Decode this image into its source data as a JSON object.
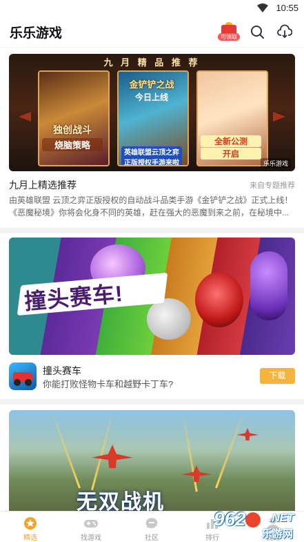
{
  "status_bar": {
    "time": "10:55"
  },
  "app_bar": {
    "title": "乐乐游戏",
    "gift_label": "可领取"
  },
  "feature_card": {
    "banner_heading": "九 月 精 品 推 荐",
    "posters": [
      {
        "line1": "独创战斗",
        "line2": "烧脑策略"
      },
      {
        "line1": "金铲铲之战",
        "line2": "今日上线",
        "line3": "英雄联盟云顶之弈正版授权手游来啦"
      },
      {
        "line1": "全新公测",
        "line2": "开启"
      }
    ],
    "brand_badge": "乐乐游戏",
    "title": "九月上精选推荐",
    "source": "来自专题推荐",
    "description": "由英雄联盟 云顶之弈正版授权的自动战斗品类手游《金铲铲之战》正式上线！《恶魔秘境》你将会化身不同的英雄，赶在强大的恶魔到来之前，在秘境中..."
  },
  "game_card": {
    "banner_text": "撞头赛车!",
    "name": "撞头赛车",
    "subtitle": "你能打败怪物卡车和越野卡丁车?",
    "download_label": "下载"
  },
  "game_card_2": {
    "banner_text": "无双战机"
  },
  "tab_bar": {
    "tabs": [
      {
        "label": "精选",
        "icon": "star-icon",
        "active": true
      },
      {
        "label": "找游戏",
        "icon": "gamepad-icon",
        "active": false
      },
      {
        "label": "社区",
        "icon": "chat-bubble-icon",
        "active": false
      },
      {
        "label": "排行",
        "icon": "ranking-icon",
        "active": false
      },
      {
        "label": "我的",
        "icon": "profile-icon",
        "active": false
      }
    ]
  },
  "watermark": {
    "number": "962",
    "domain": ".NET",
    "cn": "乐游网"
  },
  "colors": {
    "accent": "#f6a326",
    "download_button": "#f6b33c",
    "gift_red": "#e53935"
  }
}
